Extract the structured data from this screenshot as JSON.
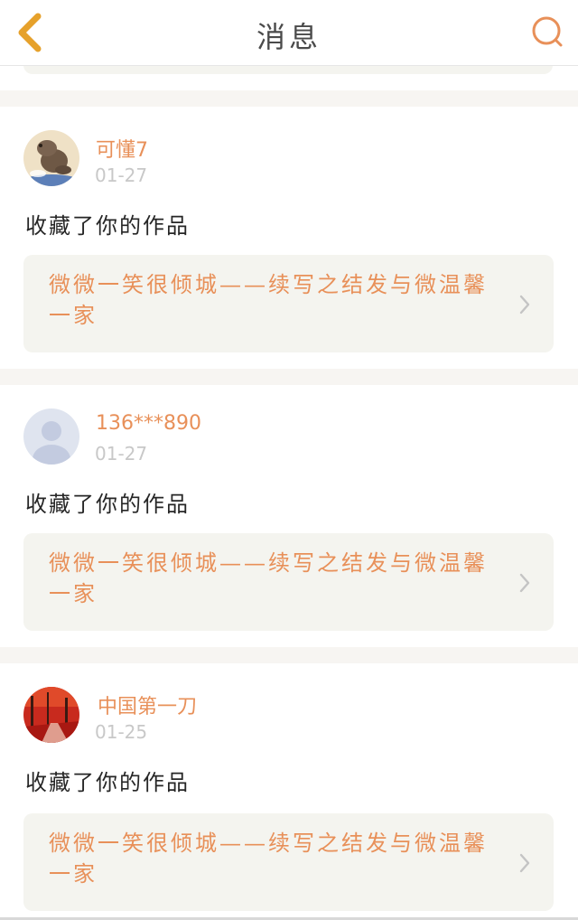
{
  "header": {
    "title": "消息"
  },
  "messages": [
    {
      "username": "可懂7",
      "time": "01-27",
      "action": "收藏了你的作品",
      "work_title": "微微一笑很倾城——续写之结发与微温馨一家",
      "avatar": "squirrel-avatar"
    },
    {
      "username": "136***890",
      "time": "01-27",
      "action": "收藏了你的作品",
      "work_title": "微微一笑很倾城——续写之结发与微温馨一家",
      "avatar": "default-avatar"
    },
    {
      "username": "中国第一刀",
      "time": "01-25",
      "action": "收藏了你的作品",
      "work_title": "微微一笑很倾城——续写之结发与微温馨一家",
      "avatar": "red-forest-avatar"
    }
  ],
  "colors": {
    "accent": "#e89059",
    "card_bg": "#f4f4ef",
    "back_arrow": "#e6a12b"
  },
  "icons": {
    "back": "back-chevron-icon",
    "search": "search-icon",
    "card_arrow": "chevron-right-icon"
  }
}
